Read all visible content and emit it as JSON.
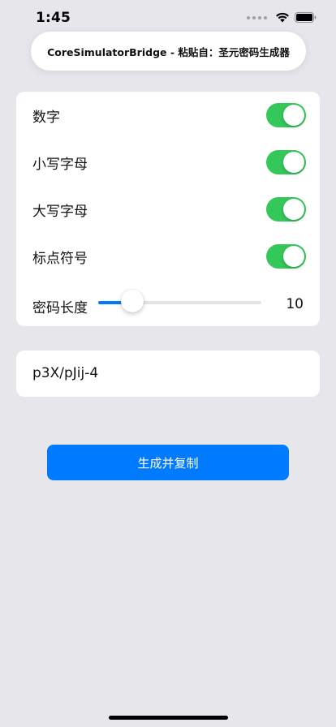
{
  "status_bar": {
    "time": "1:45"
  },
  "paste_banner": {
    "text": "CoreSimulatorBridge - 粘贴自：圣元密码生成器"
  },
  "options": [
    {
      "label": "数字",
      "enabled": true
    },
    {
      "label": "小写字母",
      "enabled": true
    },
    {
      "label": "大写字母",
      "enabled": true
    },
    {
      "label": "标点符号",
      "enabled": true
    }
  ],
  "length": {
    "label": "密码长度",
    "value": "10",
    "fraction": 0.21
  },
  "password": {
    "text": "p3X/pJij-4"
  },
  "generate_button": {
    "label": "生成并复制"
  },
  "colors": {
    "accent": "#007aff",
    "toggle_on": "#34c759",
    "background": "#e6e6eb"
  }
}
